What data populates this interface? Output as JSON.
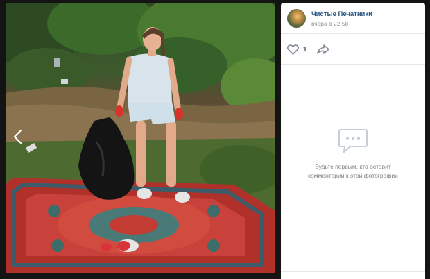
{
  "post": {
    "group_name": "Чистые Печатники",
    "time": "вчера в 22:58",
    "likes": "1"
  },
  "comments": {
    "empty_text": "Будьте первым, кто оставит\nкомментарий к этой фотографии"
  },
  "icons": {
    "prev": "chevron-left-icon",
    "like": "heart-icon",
    "share": "share-arrow-icon",
    "comments": "speech-bubble-icon"
  },
  "colors": {
    "link": "#2a5885",
    "muted": "#939393",
    "viewer_bg": "#141414",
    "panel_bg": "#ffffff"
  }
}
